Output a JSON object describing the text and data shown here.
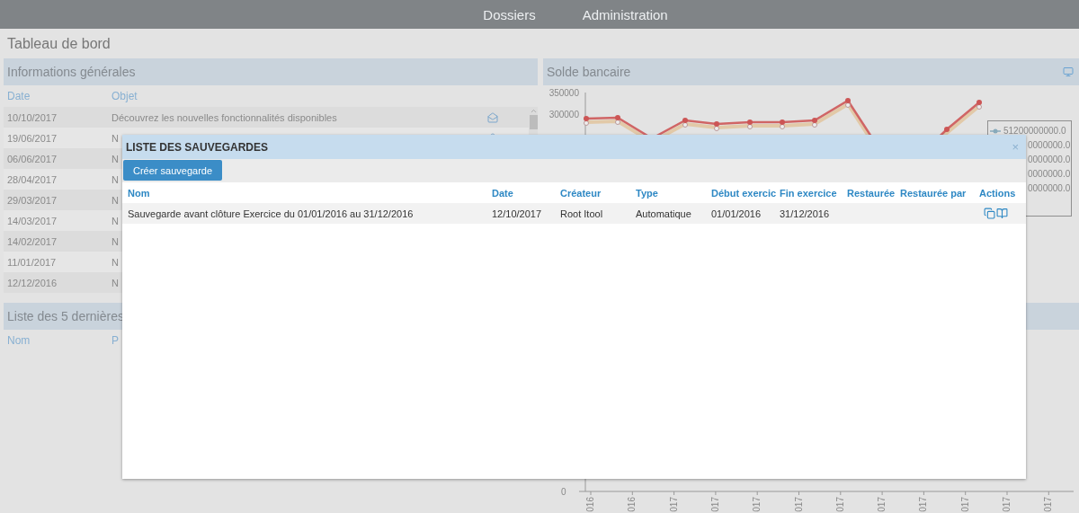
{
  "nav": {
    "items": [
      "Dossiers",
      "Administration"
    ]
  },
  "page_title": "Tableau de bord",
  "info_panel": {
    "title": "Informations générales",
    "columns": [
      "Date",
      "Objet"
    ],
    "rows": [
      {
        "date": "10/10/2017",
        "object": "Découvrez les nouvelles fonctionnalités disponibles"
      },
      {
        "date": "19/06/2017",
        "object": "N"
      },
      {
        "date": "06/06/2017",
        "object": "N"
      },
      {
        "date": "28/04/2017",
        "object": "N"
      },
      {
        "date": "29/03/2017",
        "object": "N"
      },
      {
        "date": "14/03/2017",
        "object": "N"
      },
      {
        "date": "14/02/2017",
        "object": "N"
      },
      {
        "date": "11/01/2017",
        "object": "N"
      },
      {
        "date": "12/12/2016",
        "object": "N"
      }
    ]
  },
  "recent_panel": {
    "title": "Liste des 5 dernières",
    "columns": [
      "Nom",
      "P"
    ]
  },
  "bank_panel": {
    "title": "Solde bancaire",
    "yticks": [
      "350000",
      "300000"
    ],
    "legend": [
      "51200000000.0",
      "0000000.0",
      "0000000.0",
      "0000000.0",
      "0000000.0"
    ],
    "zero_tick": "0",
    "xlabels": [
      "016",
      "016",
      "017",
      "017",
      "017",
      "017",
      "017",
      "017",
      "017",
      "017",
      "017",
      "017"
    ]
  },
  "modal": {
    "title": "LISTE DES SAUVEGARDES",
    "close": "×",
    "create_button": "Créer sauvegarde",
    "columns": [
      "Nom",
      "Date",
      "Créateur",
      "Type",
      "Début exercic",
      "Fin exercice",
      "Restaurée",
      "Restaurée par",
      "Actions"
    ],
    "rows": [
      {
        "cells": [
          "Sauvegarde avant clôture Exercice du 01/01/2016 au 31/12/2016",
          "12/10/2017",
          "Root Itool",
          "Automatique",
          "01/01/2016",
          "31/12/2016",
          "",
          ""
        ]
      }
    ]
  }
}
